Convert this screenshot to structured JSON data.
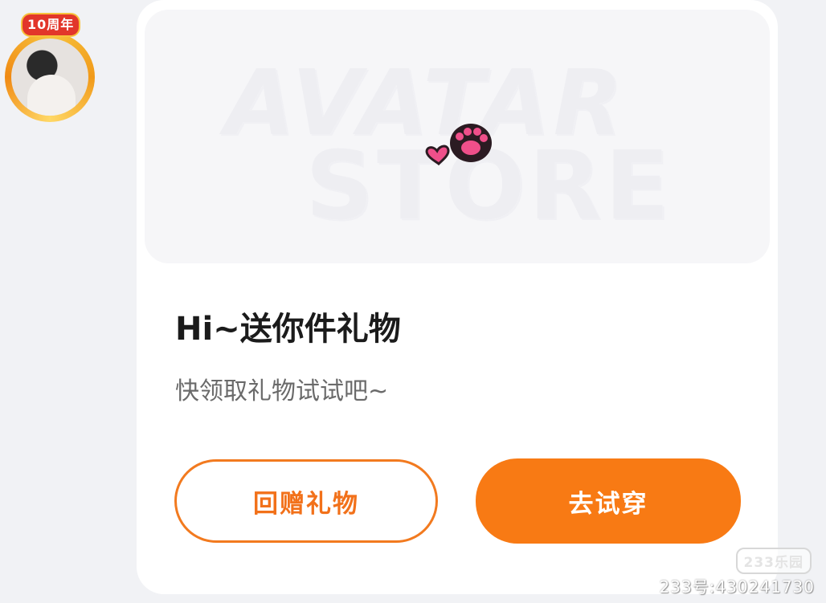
{
  "avatar": {
    "badge": "10周年"
  },
  "banner": {
    "line1": "AVATAR",
    "line2": "STORE",
    "paw_icon": "pink-paw-icon"
  },
  "dialog": {
    "title": "Hi~送你件礼物",
    "subtitle": "快领取礼物试试吧~",
    "return_gift_label": "回赠礼物",
    "try_on_label": "去试穿"
  },
  "watermark": {
    "logo": "233乐园",
    "id": "233号:430241730"
  },
  "colors": {
    "accent": "#f87a14",
    "outline": "#f27a1f",
    "paw": "#ef4f8a"
  }
}
